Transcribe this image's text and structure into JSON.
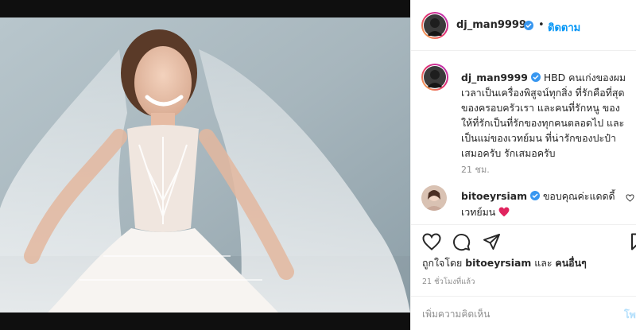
{
  "header": {
    "username": "dj_man9999",
    "separator": "•",
    "follow_label": "ติดตาม"
  },
  "caption": {
    "username": "dj_man9999",
    "text": "HBD คนเก่งของผมเวลาเป็นเครื่องพิสูจน์ทุกสิ่ง ที่รักคือที่สุด ของครอบครัวเรา และคนที่รักหนู ของให้ที่รักเป็นที่รักของทุกคนตลอดไป และเป็นแม่ของเวทย์มน ที่น่ารักของปะป๋า เสมอครับ รักเสมอครับ",
    "time": "21 ชม."
  },
  "comment": {
    "username": "bitoeyrsiam",
    "text": "ขอบคุณค่ะแดดดี้ เวทย์มน"
  },
  "likes": {
    "prefix": "ถูกใจโดย",
    "user": "bitoeyrsiam",
    "and": "และ",
    "others": "คนอื่นๆ"
  },
  "post_time": "21 ชั่วโมงที่แล้ว",
  "comment_box": {
    "placeholder": "เพิ่มความคิดเห็น",
    "post_label": "โพสต์"
  },
  "icons": {
    "verified": "verified-badge-icon",
    "like": "heart-icon",
    "comment": "comment-icon",
    "share": "share-icon",
    "save": "bookmark-icon",
    "comment_like": "heart-icon",
    "emoji": "red-heart-emoji"
  },
  "colors": {
    "link": "#0095f6",
    "verified": "#3897f0",
    "post_disabled": "#b2dffc",
    "heart_emoji": "#e0245e"
  }
}
